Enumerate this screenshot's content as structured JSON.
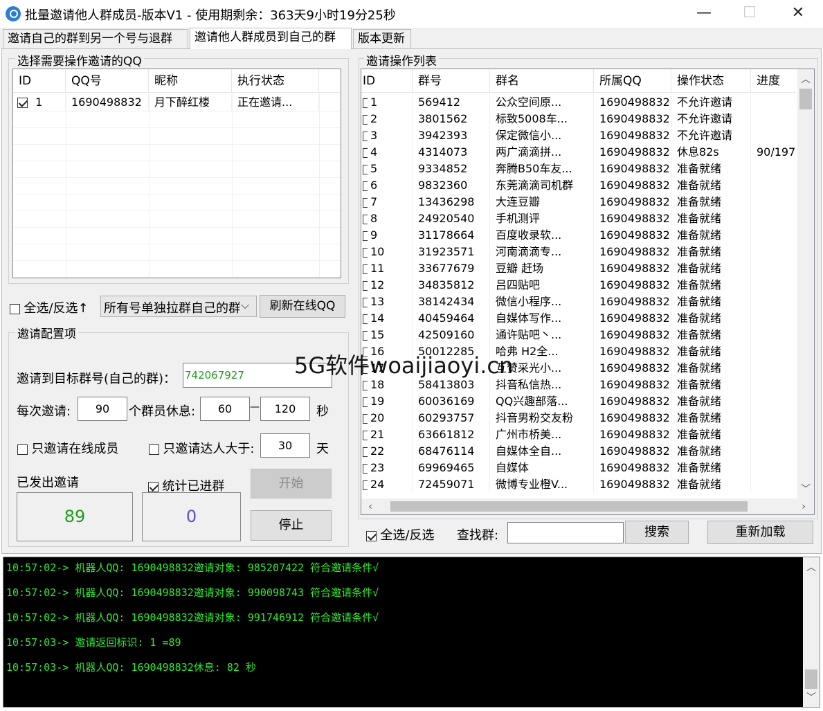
{
  "window": {
    "title": "批量邀请他人群成员-版本V1 - 使用期剩余：363天9小时19分25秒",
    "minimize": "—",
    "maximize": "☐",
    "close": "✕"
  },
  "tabs": [
    {
      "label": "邀请自己的群到另一个号与退群"
    },
    {
      "label": "邀请他人群成员到自己的群"
    },
    {
      "label": "版本更新"
    }
  ],
  "left": {
    "qq_group_label": "选择需要操作邀请的QQ",
    "qq_columns": [
      "ID",
      "QQ号",
      "昵称",
      "执行状态"
    ],
    "qq_rows": [
      {
        "id": "1",
        "qq": "1690498832",
        "nick": "月下醉红楼",
        "status": "正在邀请..."
      }
    ],
    "select_all_label": "全选/反选↑",
    "mode_select": "所有号单独拉群自己的群",
    "refresh_button": "刷新在线QQ",
    "config_label": "邀请配置项",
    "target_label": "邀请到目标群号(自己的群)：",
    "target_value": "742067927",
    "per_invite_label": "每次邀请:",
    "per_invite_value": "90",
    "rest_label": "个群员休息:",
    "rest_min": "60",
    "dash": "—",
    "rest_max": "120",
    "sec_unit": "秒",
    "online_only_label": "只邀请在线成员",
    "expert_label": "只邀请达人大于:",
    "expert_days": "30",
    "day_unit": "天",
    "sent_label": "已发出邀请",
    "sent_count": "89",
    "stat_joined_label": "统计已进群",
    "joined_count": "0",
    "start_button": "开始",
    "stop_button": "停止"
  },
  "right": {
    "group_label": "邀请操作列表",
    "columns": [
      "ID",
      "群号",
      "群名",
      "所属QQ",
      "操作状态",
      "进度"
    ],
    "rows": [
      {
        "id": "1",
        "group": "569412",
        "name": "公众空间原...",
        "qq": "1690498832",
        "status": "不允许邀请",
        "progress": ""
      },
      {
        "id": "2",
        "group": "3801562",
        "name": "标致5008车...",
        "qq": "1690498832",
        "status": "不允许邀请",
        "progress": ""
      },
      {
        "id": "3",
        "group": "3942393",
        "name": "保定微信小...",
        "qq": "1690498832",
        "status": "不允许邀请",
        "progress": ""
      },
      {
        "id": "4",
        "group": "4314073",
        "name": "两广滴滴拼...",
        "qq": "1690498832",
        "status": "休息82s",
        "progress": "90/197"
      },
      {
        "id": "5",
        "group": "9334852",
        "name": "奔腾B50车友...",
        "qq": "1690498832",
        "status": "准备就绪",
        "progress": ""
      },
      {
        "id": "6",
        "group": "9832360",
        "name": "东莞滴滴司机群",
        "qq": "1690498832",
        "status": "准备就绪",
        "progress": ""
      },
      {
        "id": "7",
        "group": "13436298",
        "name": "大连豆瓣",
        "qq": "1690498832",
        "status": "准备就绪",
        "progress": ""
      },
      {
        "id": "8",
        "group": "24920540",
        "name": "手机测评",
        "qq": "1690498832",
        "status": "准备就绪",
        "progress": ""
      },
      {
        "id": "9",
        "group": "31178664",
        "name": "百度收录软...",
        "qq": "1690498832",
        "status": "准备就绪",
        "progress": ""
      },
      {
        "id": "10",
        "group": "31923571",
        "name": "河南滴滴专...",
        "qq": "1690498832",
        "status": "准备就绪",
        "progress": ""
      },
      {
        "id": "11",
        "group": "33677679",
        "name": "豆瓣 赶场",
        "qq": "1690498832",
        "status": "准备就绪",
        "progress": ""
      },
      {
        "id": "12",
        "group": "34835812",
        "name": "吕四贴吧",
        "qq": "1690498832",
        "status": "准备就绪",
        "progress": ""
      },
      {
        "id": "13",
        "group": "38142434",
        "name": "微信小程序...",
        "qq": "1690498832",
        "status": "准备就绪",
        "progress": ""
      },
      {
        "id": "14",
        "group": "40459464",
        "name": "自媒体写作...",
        "qq": "1690498832",
        "status": "准备就绪",
        "progress": ""
      },
      {
        "id": "15",
        "group": "42509160",
        "name": "通许贴吧丶...",
        "qq": "1690498832",
        "status": "准备就绪",
        "progress": ""
      },
      {
        "id": "16",
        "group": "50012285",
        "name": "哈弗 H2全...",
        "qq": "1690498832",
        "status": "准备就绪",
        "progress": ""
      },
      {
        "id": "17",
        "group": "",
        "name": "互赞采光小...",
        "qq": "1690498832",
        "status": "准备就绪",
        "progress": ""
      },
      {
        "id": "18",
        "group": "58413803",
        "name": "抖音私信热...",
        "qq": "1690498832",
        "status": "准备就绪",
        "progress": ""
      },
      {
        "id": "19",
        "group": "60036169",
        "name": "QQ兴趣部落...",
        "qq": "1690498832",
        "status": "准备就绪",
        "progress": ""
      },
      {
        "id": "20",
        "group": "60293757",
        "name": "抖音男粉交友粉",
        "qq": "1690498832",
        "status": "准备就绪",
        "progress": ""
      },
      {
        "id": "21",
        "group": "63661812",
        "name": "广州市桥美...",
        "qq": "1690498832",
        "status": "准备就绪",
        "progress": ""
      },
      {
        "id": "22",
        "group": "68476114",
        "name": "自媒体全自...",
        "qq": "1690498832",
        "status": "准备就绪",
        "progress": ""
      },
      {
        "id": "23",
        "group": "69969465",
        "name": "自媒体",
        "qq": "1690498832",
        "status": "准备就绪",
        "progress": ""
      },
      {
        "id": "24",
        "group": "72459071",
        "name": "微博专业橙V...",
        "qq": "1690498832",
        "status": "准备就绪",
        "progress": ""
      }
    ],
    "select_all_label": "全选/反选",
    "search_label": "查找群:",
    "search_value": "",
    "search_button": "搜索",
    "reload_button": "重新加载"
  },
  "log": [
    "10:57:02-> 机器人QQ: 1690498832邀请对象: 985207422 符合邀请条件√",
    "10:57:02-> 机器人QQ: 1690498832邀请对象: 990098743 符合邀请条件√",
    "10:57:02-> 机器人QQ: 1690498832邀请对象: 991746912 符合邀请条件√",
    "10:57:03-> 邀请返回标识: 1 =89",
    "10:57:03-> 机器人QQ: 1690498832休息: 82 秒"
  ],
  "watermark": "5G软件woaijiaoyi.cn",
  "colors": {
    "sent_count": "#1f9a1f",
    "joined_count": "#5a4fd8",
    "log_text": "#2fea2f",
    "target_value": "#1f9a1f"
  }
}
